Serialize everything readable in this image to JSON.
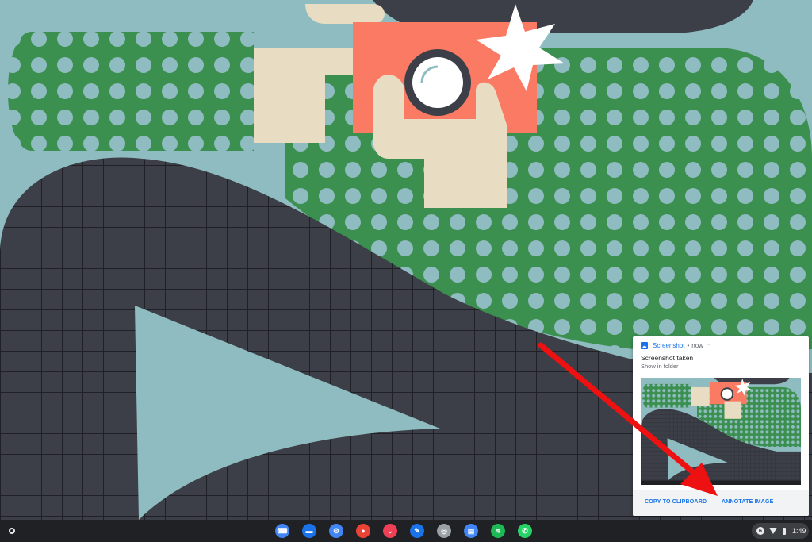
{
  "notification": {
    "app_name": "Screenshot",
    "time": "now",
    "title": "Screenshot taken",
    "subtitle": "Show in folder",
    "actions": {
      "copy": "COPY TO CLIPBOARD",
      "annotate": "ANNOTATE IMAGE"
    }
  },
  "shelf": {
    "apps": [
      {
        "icon": "keyboard-app-icon",
        "color": "#4285f4",
        "glyph": "⌨"
      },
      {
        "icon": "files-icon",
        "color": "#1a73e8",
        "glyph": "▬"
      },
      {
        "icon": "settings-gear-icon",
        "color": "#4285f4",
        "glyph": "⚙"
      },
      {
        "icon": "chrome-icon",
        "color": "#ea4335",
        "glyph": "●"
      },
      {
        "icon": "pocket-icon",
        "color": "#ef4056",
        "glyph": "⌄"
      },
      {
        "icon": "pen-app-icon",
        "color": "#1a73e8",
        "glyph": "✎"
      },
      {
        "icon": "photos-search-icon",
        "color": "#9aa0a6",
        "glyph": "◎"
      },
      {
        "icon": "messages-icon",
        "color": "#4285f4",
        "glyph": "▤"
      },
      {
        "icon": "spotify-icon",
        "color": "#1db954",
        "glyph": "≋"
      },
      {
        "icon": "whatsapp-icon",
        "color": "#25d366",
        "glyph": "✆"
      }
    ],
    "tray": {
      "notification_count": "6",
      "time": "1:49"
    }
  },
  "colors": {
    "background": "#8fbcc0",
    "green": "#3b8f4f",
    "dark": "#3c3f47",
    "skin": "#e8dcc2",
    "camera": "#fa7a64",
    "arrow": "#ee1111"
  }
}
